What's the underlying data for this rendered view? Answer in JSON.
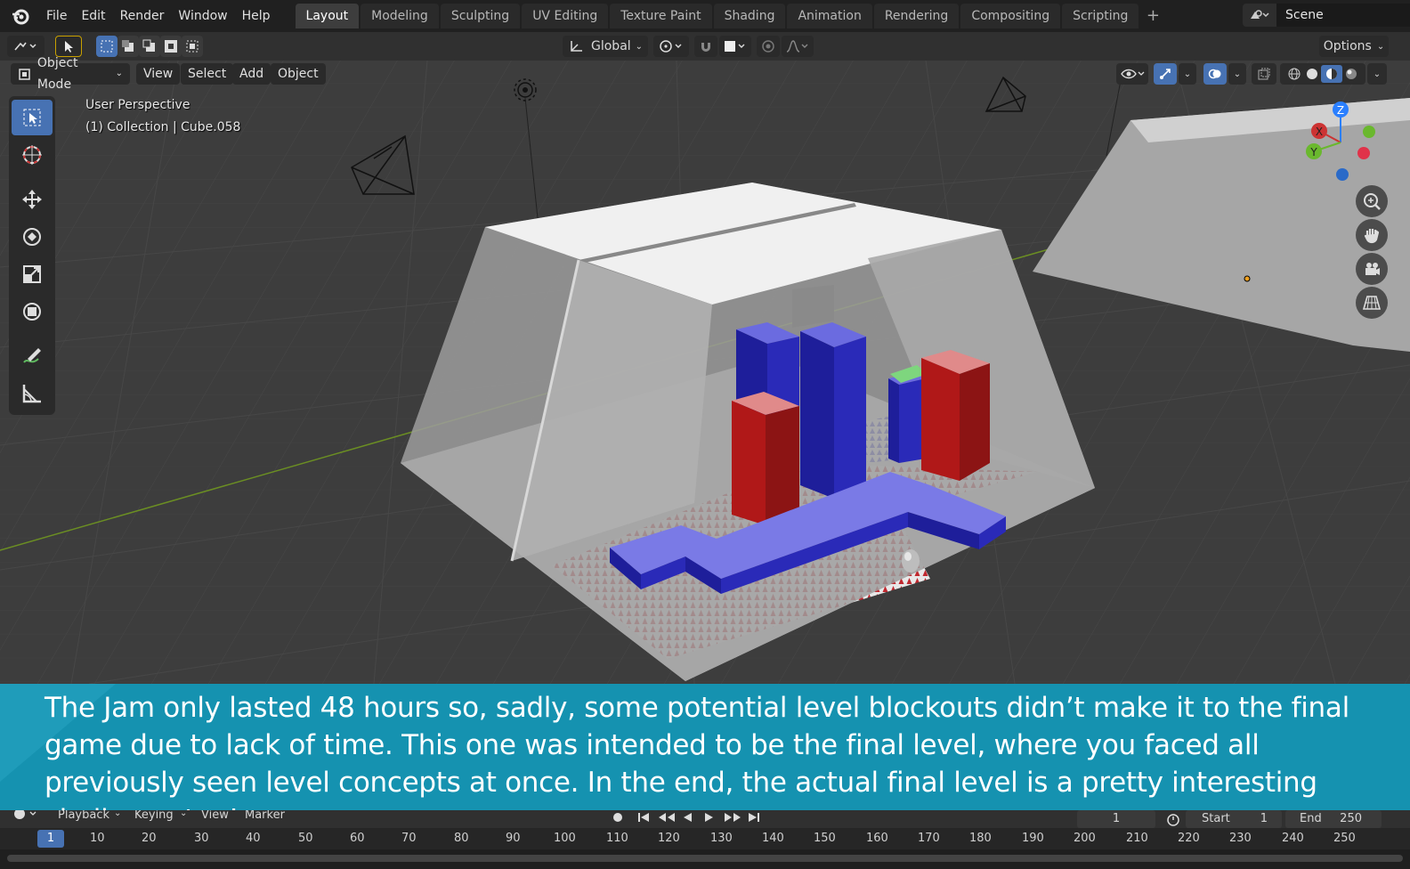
{
  "top_menu": [
    "File",
    "Edit",
    "Render",
    "Window",
    "Help"
  ],
  "workspaces": [
    {
      "label": "Layout",
      "active": true
    },
    {
      "label": "Modeling",
      "active": false
    },
    {
      "label": "Sculpting",
      "active": false
    },
    {
      "label": "UV Editing",
      "active": false
    },
    {
      "label": "Texture Paint",
      "active": false
    },
    {
      "label": "Shading",
      "active": false
    },
    {
      "label": "Animation",
      "active": false
    },
    {
      "label": "Rendering",
      "active": false
    },
    {
      "label": "Compositing",
      "active": false
    },
    {
      "label": "Scripting",
      "active": false
    }
  ],
  "scene": {
    "name": "Scene"
  },
  "tool_header": {
    "orientation": "Global",
    "options": "Options"
  },
  "viewport_header": {
    "mode": "Object Mode",
    "menus": [
      "View",
      "Select",
      "Add",
      "Object"
    ]
  },
  "viewport_info": {
    "perspective": "User Perspective",
    "active": "(1) Collection | Cube.058"
  },
  "gizmo": {
    "x": "X",
    "y": "Y",
    "z": "Z"
  },
  "caption": "The Jam only lasted 48 hours so, sadly, some potential level blockouts didn’t make it to the final game due to lack of time. This one was intended to be the final level, where you faced all previously seen level concepts at once. In the end, the actual final level is a pretty interesting challenge too!",
  "timeline": {
    "menus": [
      "Playback",
      "Keying",
      "View",
      "Marker"
    ],
    "current_frame": "1",
    "start_label": "Start",
    "start": "1",
    "end_label": "End",
    "end": "250",
    "ticks": [
      "10",
      "20",
      "30",
      "40",
      "50",
      "60",
      "70",
      "80",
      "90",
      "100",
      "110",
      "120",
      "130",
      "140",
      "150",
      "160",
      "170",
      "180",
      "190",
      "200",
      "210",
      "220",
      "230",
      "240",
      "250"
    ],
    "cursor_label": "1"
  },
  "colors": {
    "accent": "#4772b3",
    "caption_bg": "#1592b0"
  }
}
